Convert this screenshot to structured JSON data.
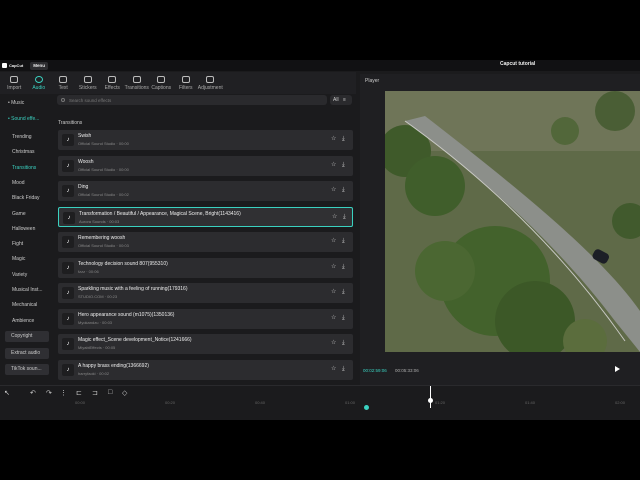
{
  "app": {
    "logo_text": "CapCut",
    "menu_label": "Menu",
    "window_title": "Capcut tutorial"
  },
  "toolbar": [
    {
      "label": "Import",
      "icon": "import-icon"
    },
    {
      "label": "Audio",
      "icon": "audio-icon",
      "active": true
    },
    {
      "label": "Text",
      "icon": "text-icon"
    },
    {
      "label": "Stickers",
      "icon": "stickers-icon"
    },
    {
      "label": "Effects",
      "icon": "effects-icon"
    },
    {
      "label": "Transitions",
      "icon": "transitions-icon"
    },
    {
      "label": "Captions",
      "icon": "captions-icon"
    },
    {
      "label": "Filters",
      "icon": "filters-icon"
    },
    {
      "label": "Adjustment",
      "icon": "adjustment-icon"
    }
  ],
  "sidebar": {
    "top_items": [
      {
        "label": "• Music"
      },
      {
        "label": "• Sound effe...",
        "active": true
      }
    ],
    "categories": [
      {
        "label": "Trending"
      },
      {
        "label": "Christmas"
      },
      {
        "label": "Transitions",
        "active": true
      },
      {
        "label": "Mood"
      },
      {
        "label": "Black Friday"
      },
      {
        "label": "Game"
      },
      {
        "label": "Halloween"
      },
      {
        "label": "Fight"
      },
      {
        "label": "Magic"
      },
      {
        "label": "Variety"
      },
      {
        "label": "Musical Inst..."
      },
      {
        "label": "Mechanical"
      },
      {
        "label": "Ambience"
      }
    ],
    "bottom_items": [
      {
        "label": "Copyright"
      },
      {
        "label": "Extract audio"
      },
      {
        "label": "TikTok soun..."
      }
    ]
  },
  "search": {
    "placeholder": "Search sound effects",
    "filter_label": "All"
  },
  "list": {
    "section_title": "Transitions",
    "items": [
      {
        "name": "Swish",
        "sub": "Official Sound Studio · 00:00"
      },
      {
        "name": "Woosh",
        "sub": "Official Sound Studio · 00:00"
      },
      {
        "name": "Ding",
        "sub": "Official Sound Studio · 00:02"
      },
      {
        "name": "Transformation / Beautiful / Appearance, Magical Scene, Bright(1143416)",
        "sub": "Aurora Sounds · 00:03",
        "selected": true
      },
      {
        "name": "Remembering woosh",
        "sub": "Official Sound Studio · 00:03"
      },
      {
        "name": "Technology decision sound 807(955310)",
        "sub": "fzzz · 00:06"
      },
      {
        "name": "Sparkling music with a feeling of running(179316)",
        "sub": "STUDIO.COM · 00:23"
      },
      {
        "name": "Hero appearance sound (m1075)(1350136)",
        "sub": "Myokandzu · 00:03"
      },
      {
        "name": "Magic effect_Scene development_Notice(1241666)",
        "sub": "MiyabiEffects · 00:05"
      },
      {
        "name": "A happy brass ending(1366692)",
        "sub": "harryfaoki · 00:02"
      }
    ]
  },
  "player": {
    "title": "Player",
    "current_time": "00:02:59:06",
    "duration": "00:05:33:06"
  },
  "timeline": {
    "ticks": [
      "00:00",
      "00:20",
      "00:40",
      "01:00",
      "01:20",
      "01:40",
      "02:00"
    ]
  }
}
